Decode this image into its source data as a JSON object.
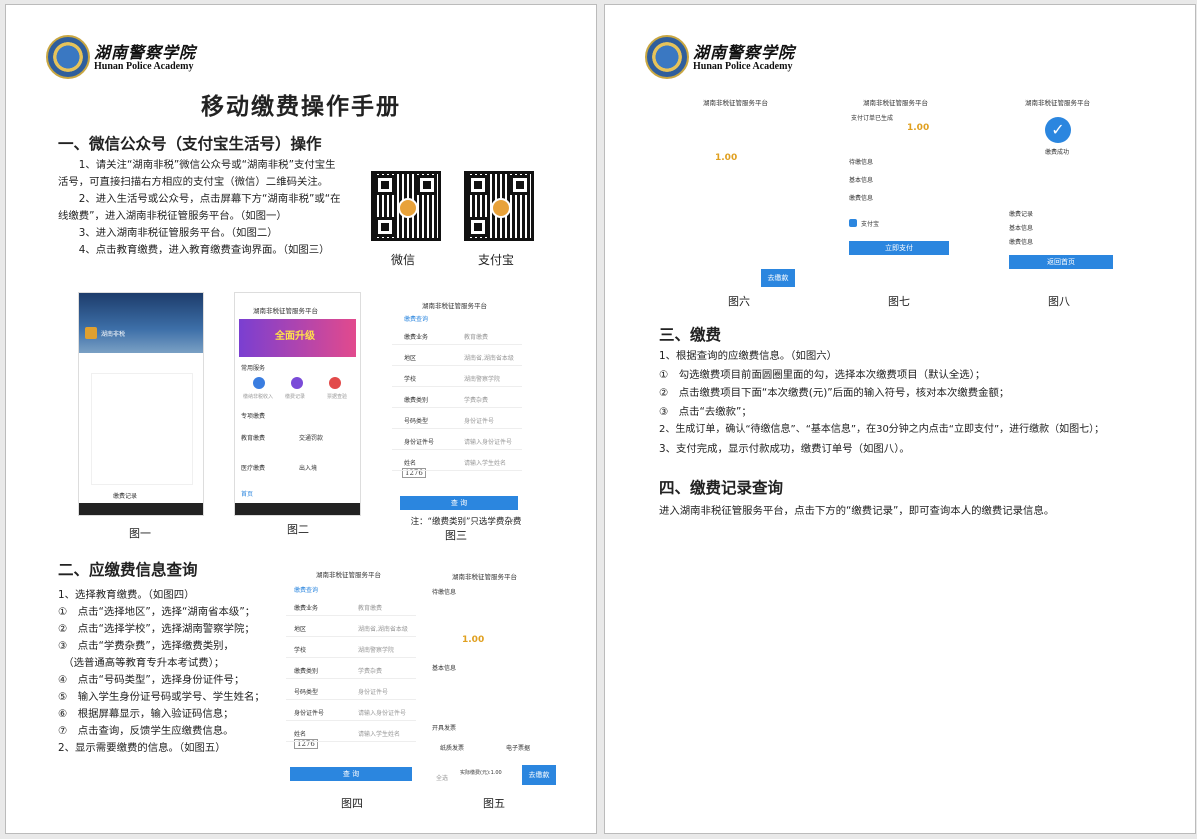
{
  "logo": {
    "cn": "湖南警察学院",
    "en": "Hunan Police Academy"
  },
  "page1": {
    "title": "移动缴费操作手册",
    "sec1": {
      "heading": "一、微信公众号（支付宝生活号）操作",
      "lines": [
        "　　1、请关注“湖南非税”微信公众号或“湖南非税”支付宝生",
        "活号，可直接扫描右方相应的支付宝（微信）二维码关注。",
        "　　2、进入生活号或公众号，点击屏幕下方“湖南非税”或“在",
        "线缴费”，进入湖南非税征管服务平台。（如图一）",
        "　　3、进入湖南非税征管服务平台。（如图二）",
        "　　4、点击教育缴费，进入教育缴费查询界面。（如图三）"
      ],
      "qr_wechat": "微信",
      "qr_alipay": "支付宝"
    },
    "fig1": {
      "caption": "图一",
      "banner": "湖南非税",
      "footer": "缴费记录"
    },
    "fig2": {
      "caption": "图二",
      "header": "湖南非税征管服务平台",
      "banner": "全面升级",
      "s1": "常用服务",
      "s2": "专项缴费",
      "a": "缴纳非税收入",
      "b": "缴费记录",
      "c": "票据查验",
      "d": "教育缴费",
      "e": "交通罚款",
      "f": "医疗缴费",
      "g": "出入境",
      "nav": "首页"
    },
    "fig3": {
      "caption": "图三",
      "header": "湖南非税征管服务平台",
      "sub": "缴费查询",
      "rows": [
        [
          "缴费业务",
          "教育缴费"
        ],
        [
          "地区",
          "湖南省,湖南省本级"
        ],
        [
          "学校",
          "湖南警察学院"
        ],
        [
          "缴费类别",
          "学费杂费"
        ],
        [
          "号码类型",
          "身份证件号"
        ],
        [
          "身份证件号",
          "请输入身份证件号"
        ],
        [
          "姓名",
          "请输入学生姓名"
        ]
      ],
      "captcha": "1276",
      "button": "查 询",
      "note": "注：“缴费类别”只选学费杂费"
    },
    "sec2": {
      "heading": "二、应缴费信息查询",
      "lines": [
        "1、选择教育缴费。（如图四）",
        "①　点击“选择地区”，选择“湖南省本级”；",
        "②　点击“选择学校”，选择湖南警察学院；",
        "③　点击“学费杂费”，选择缴费类别，",
        "　（选普通高等教育专升本考试费）；",
        "④　点击“号码类型”，选择身份证件号；",
        "⑤　输入学生身份证号码或学号、学生姓名；",
        "⑥　根据屏幕显示，输入验证码信息；",
        "⑦　点击查询，反馈学生应缴费信息。",
        "2、显示需要缴费的信息。（如图五）"
      ]
    },
    "fig4": {
      "caption": "图四",
      "button": "查 询"
    },
    "fig5": {
      "caption": "图五",
      "header": "湖南非税征管服务平台",
      "s1": "待缴信息",
      "amt": "1.00",
      "s2": "基本信息",
      "s3": "开具发票",
      "t1": "纸质发票",
      "t2": "电子票据",
      "total": "实际缴费(元):1.00",
      "button": "去缴款",
      "all": "全选"
    }
  },
  "page2": {
    "fig6": {
      "caption": "图六",
      "header": "湖南非税征管服务平台",
      "amt": "1.00",
      "button": "去缴款"
    },
    "fig7": {
      "caption": "图七",
      "header": "湖南非税征管服务平台",
      "sub": "支付订单已生成",
      "amt": "1.00",
      "r1": "待缴信息",
      "r2": "基本信息",
      "r3": "缴费信息",
      "pay": "支付宝",
      "button": "立即支付"
    },
    "fig8": {
      "caption": "图八",
      "header": "湖南非税征管服务平台",
      "ok": "缴费成功",
      "r1": "缴费记录",
      "r2": "基本信息",
      "r3": "缴费信息",
      "button": "返回首页"
    },
    "sec3": {
      "heading": "三、缴费",
      "lines": [
        "1、根据查询的应缴费信息。（如图六）",
        "①　勾选缴费项目前面圆圈里面的勾，选择本次缴费项目（默认全选）；",
        "②　点击缴费项目下面“本次缴费(元)”后面的输入符号，核对本次缴费金额；",
        "③　点击“去缴款”；",
        "2、生成订单，确认“待缴信息”、“基本信息”，在30分钟之内点击“立即支付”，进行缴款（如图七）；",
        "3、支付完成，显示付款成功，缴费订单号（如图八）。"
      ]
    },
    "sec4": {
      "heading": "四、缴费记录查询",
      "text": "进入湖南非税征管服务平台，点击下方的“缴费记录”，即可查询本人的缴费记录信息。"
    }
  }
}
